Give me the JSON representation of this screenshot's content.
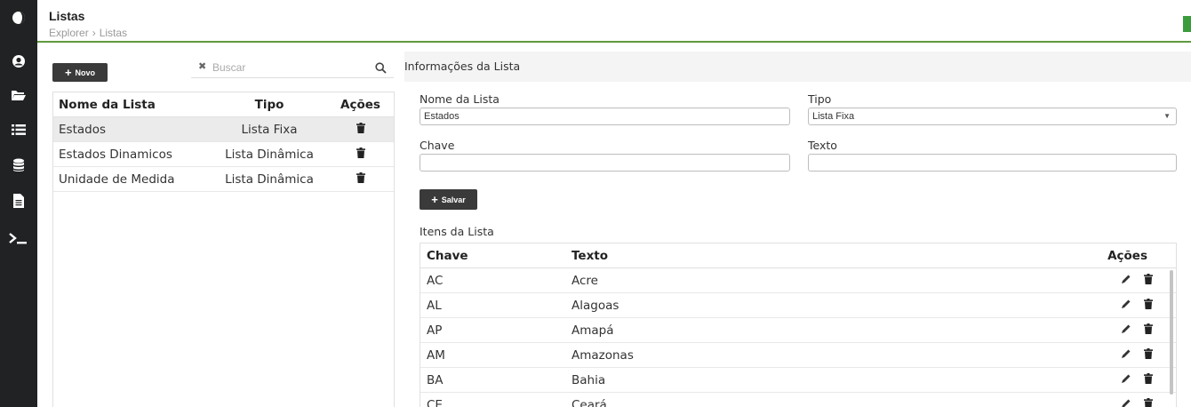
{
  "header": {
    "title": "Listas",
    "breadcrumb": [
      "Explorer",
      "Listas"
    ],
    "breadcrumb_separator": "›"
  },
  "sidebar": {
    "icons": [
      "theme-toggle-icon",
      "user-icon",
      "folder-icon",
      "list-icon",
      "database-icon",
      "document-icon",
      "terminal-icon"
    ]
  },
  "left_panel": {
    "new_button_label": "Novo",
    "search_placeholder": "Buscar",
    "columns": [
      "Nome da Lista",
      "Tipo",
      "Ações"
    ],
    "rows": [
      {
        "nome": "Estados",
        "tipo": "Lista Fixa"
      },
      {
        "nome": "Estados Dinamicos",
        "tipo": "Lista Dinâmica"
      },
      {
        "nome": "Unidade de Medida",
        "tipo": "Lista Dinâmica"
      }
    ]
  },
  "form": {
    "section_title": "Informações da Lista",
    "nome_label": "Nome da Lista",
    "nome_value": "Estados",
    "tipo_label": "Tipo",
    "tipo_value": "Lista Fixa",
    "chave_label": "Chave",
    "chave_value": "",
    "texto_label": "Texto",
    "texto_value": "",
    "save_button_label": "Salvar"
  },
  "items": {
    "title": "Itens da Lista",
    "columns": [
      "Chave",
      "Texto",
      "Ações"
    ],
    "rows": [
      {
        "chave": "AC",
        "texto": "Acre"
      },
      {
        "chave": "AL",
        "texto": "Alagoas"
      },
      {
        "chave": "AP",
        "texto": "Amapá"
      },
      {
        "chave": "AM",
        "texto": "Amazonas"
      },
      {
        "chave": "BA",
        "texto": "Bahia"
      },
      {
        "chave": "CE",
        "texto": "Ceará"
      }
    ]
  },
  "colors": {
    "sidebar_bg": "#202224",
    "accent_green": "#5f9a3d",
    "button_dark": "#3a3a3a",
    "selected_row": "#ebebeb"
  }
}
